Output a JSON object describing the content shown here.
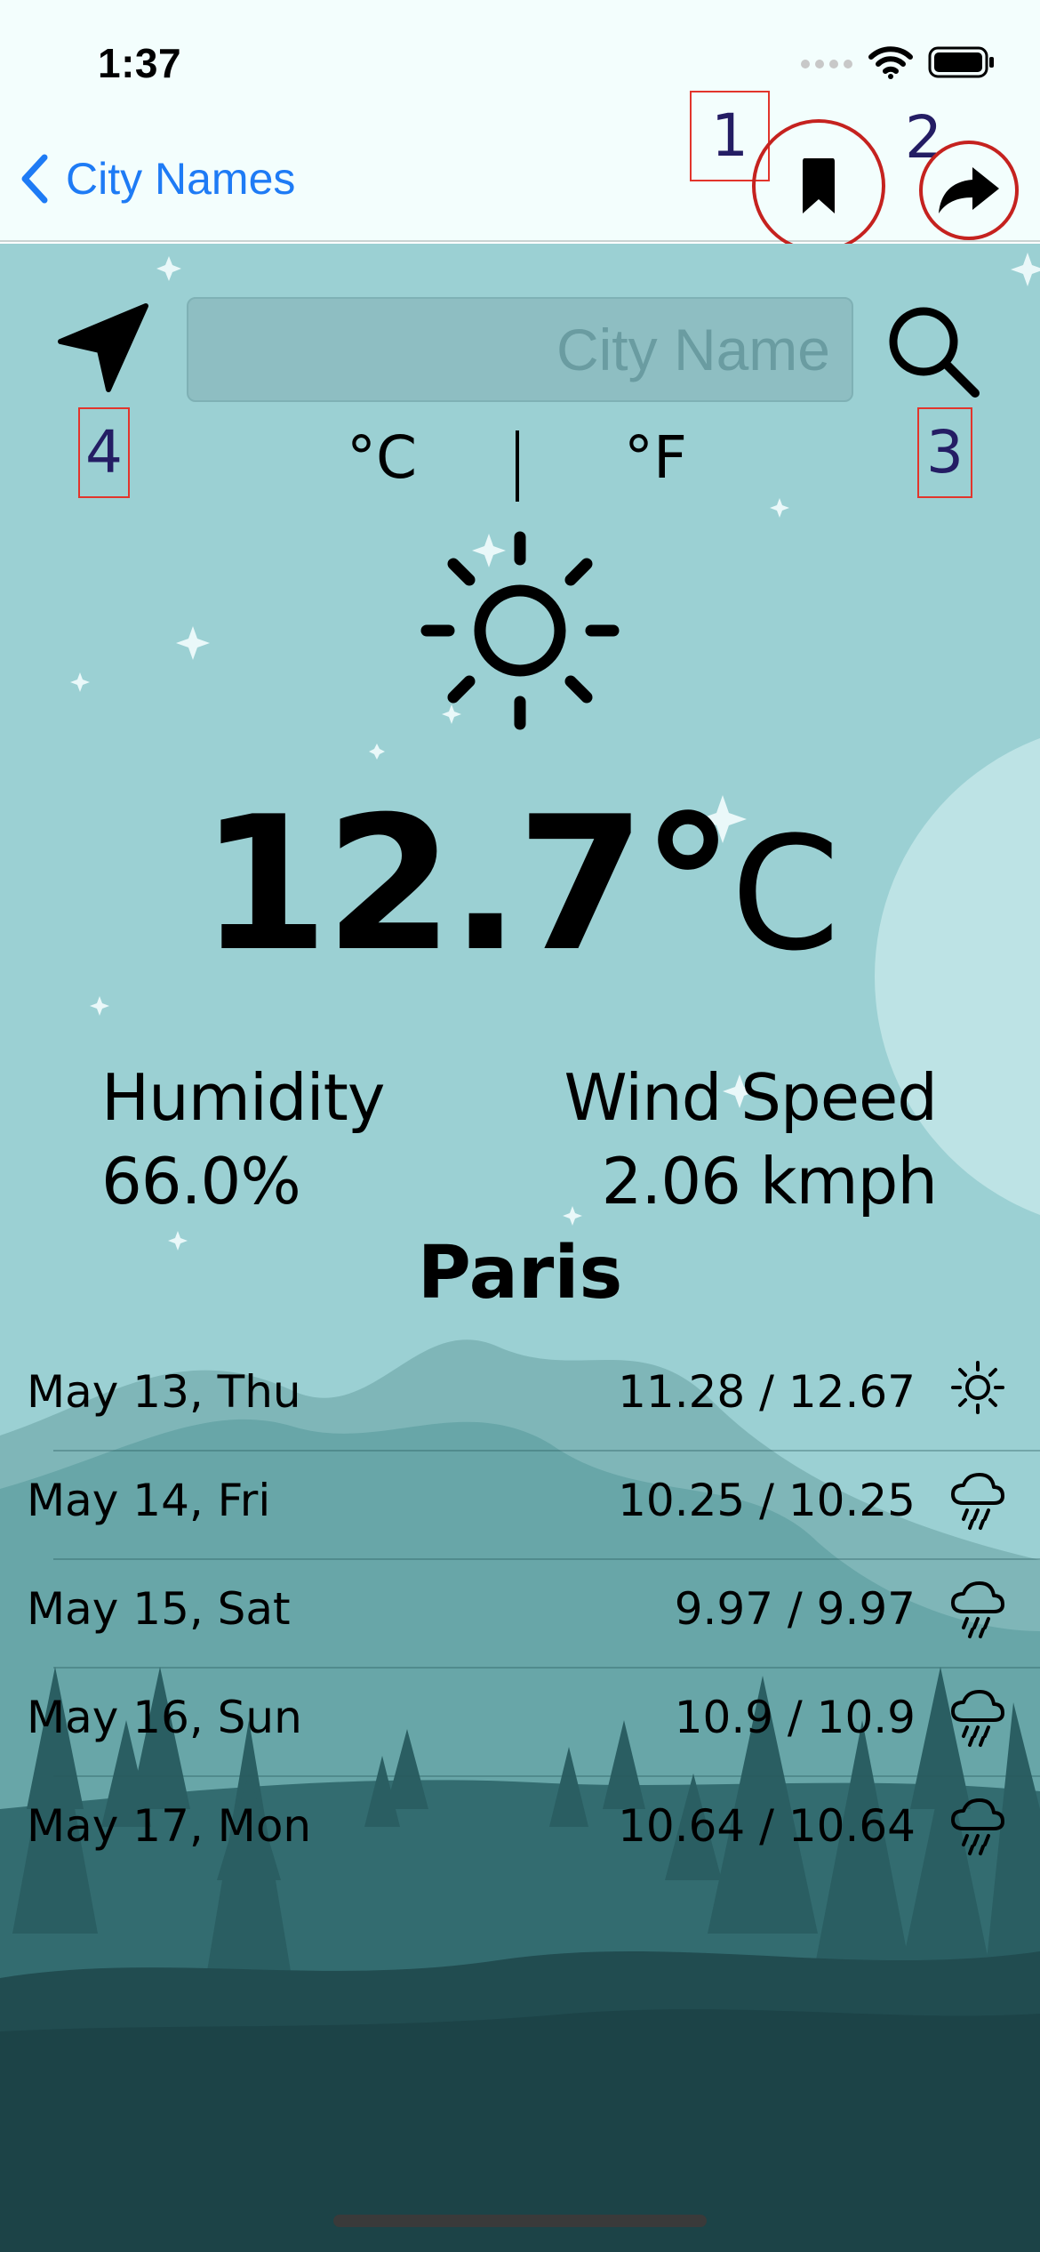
{
  "status_bar": {
    "time": "1:37"
  },
  "nav": {
    "back_label": "City Names",
    "bookmark_tag": "1",
    "share_tag": "2"
  },
  "search": {
    "placeholder": "City Name",
    "search_tag": "3",
    "location_tag": "4"
  },
  "units": {
    "celsius": "°C",
    "fahrenheit": "°F"
  },
  "current": {
    "icon": "sun-icon",
    "temperature": "12.7°",
    "unit": "C",
    "humidity_label": "Humidity",
    "humidity_value": "66.0%",
    "wind_label": "Wind Speed",
    "wind_value": "2.06 kmph",
    "city": "Paris"
  },
  "forecast": [
    {
      "date": "May 13, Thu",
      "temps": "11.28 / 12.67",
      "icon": "sun-icon"
    },
    {
      "date": "May 14, Fri",
      "temps": "10.25 / 10.25",
      "icon": "rain-cloud-icon"
    },
    {
      "date": "May 15, Sat",
      "temps": "9.97 / 9.97",
      "icon": "rain-cloud-icon"
    },
    {
      "date": "May 16, Sun",
      "temps": "10.9 / 10.9",
      "icon": "rain-cloud-icon"
    },
    {
      "date": "May 17, Mon",
      "temps": "10.64 / 10.64",
      "icon": "rain-cloud-icon"
    }
  ],
  "colors": {
    "accent": "#1e7bf5",
    "sky": "#9bd0d3",
    "annotation": "#c5221f",
    "tag_text": "#241d64"
  }
}
